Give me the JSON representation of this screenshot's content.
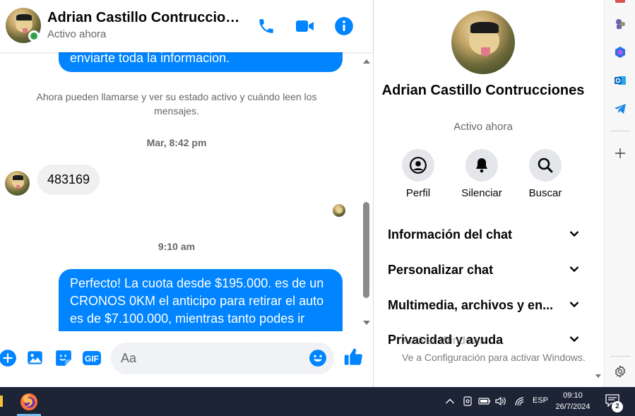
{
  "colors": {
    "accent": "#0084ff",
    "online": "#31a24c",
    "bubble_in": "#f0f0f0",
    "muted": "#65676b",
    "taskbar": "#1c2436"
  },
  "header": {
    "name": "Adrian Castillo Contruccio…",
    "status": "Activo ahora",
    "buttons": [
      "phone-icon",
      "video-icon",
      "info-icon"
    ]
  },
  "messages": {
    "outgoing_top_text": "enviarte toda la informacion.",
    "system_note": "Ahora pueden llamarse y ver su estado activo y cuándo leen los mensajes.",
    "timestamp_1": "Mar, 8:42 pm",
    "incoming_text": "483169",
    "timestamp_2": "9:10 am",
    "outgoing_bottom_text": "Perfecto! La cuota desde $195.000. es de un CRONOS 0KM el anticipo para retirar el auto es de $7.100.000, mientras tanto podes ir"
  },
  "composer": {
    "placeholder": "Aa",
    "icons": [
      "plus-icon",
      "image-icon",
      "sticker-icon",
      "gif-icon",
      "emoji-icon",
      "like-icon"
    ],
    "gif_label": "GIF"
  },
  "panel": {
    "name": "Adrian Castillo Contrucciones",
    "status": "Activo ahora",
    "actions": [
      {
        "label": "Perfil",
        "icon": "profile-icon"
      },
      {
        "label": "Silenciar",
        "icon": "bell-icon"
      },
      {
        "label": "Buscar",
        "icon": "search-icon"
      }
    ],
    "sections": [
      "Información del chat",
      "Personalizar chat",
      "Multimedia, archivos y en...",
      "Privacidad y ayuda"
    ],
    "watermark_title": "Activar Windows",
    "watermark_text": "Ve a Configuración para activar Windows."
  },
  "browser_sidebar": {
    "icons": [
      "app-icon-chess",
      "copilot-icon",
      "outlook-icon",
      "telegram-icon",
      "add-icon",
      "settings-icon"
    ]
  },
  "taskbar": {
    "language": "ESP",
    "time": "09:10",
    "date": "26/7/2024",
    "notifications": "2"
  }
}
